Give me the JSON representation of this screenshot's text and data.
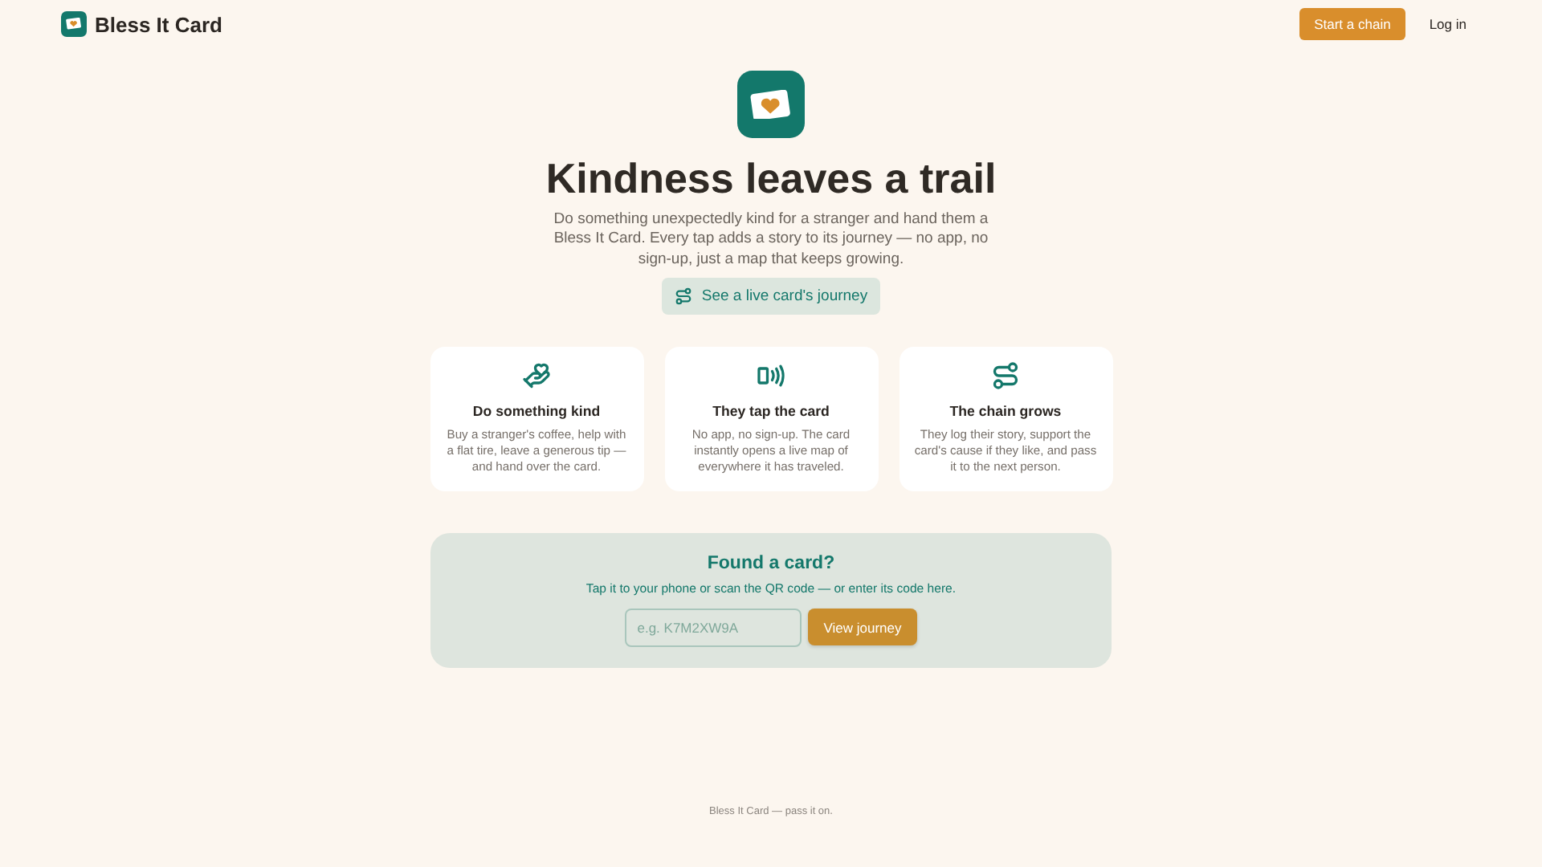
{
  "header": {
    "brand": "Bless It Card",
    "buttons": [
      {
        "label": "Start a chain",
        "kind": "primary"
      },
      {
        "label": "Log in",
        "kind": "plain"
      }
    ]
  },
  "hero": {
    "title": "Kindness leaves a trail",
    "text": "Do something unexpectedly kind for a stranger and hand them a Bless It Card. Every tap adds a story to its journey — no app, no sign-up, just a map that keeps growing.",
    "button": "See a live card's journey"
  },
  "steps": [
    {
      "kind": "give",
      "title": "Do something kind",
      "text": "Buy a stranger's coffee, help with a flat tire, leave a generous tip — and hand over the card."
    },
    {
      "kind": "tap",
      "title": "They tap the card",
      "text": "No app, no sign-up. The card instantly opens a live map of everywhere it has traveled."
    },
    {
      "kind": "route",
      "title": "The chain grows",
      "text": "They log their story, support the card's cause if they like, and pass it to the next person."
    }
  ],
  "lookup": {
    "title": "Found a card?",
    "text": "Tap it to your phone or scan the QR code — or enter its code here.",
    "placeholder": "e.g. K7M2XW9A",
    "button": "View journey"
  },
  "footer": "Bless It Card — pass it on."
}
